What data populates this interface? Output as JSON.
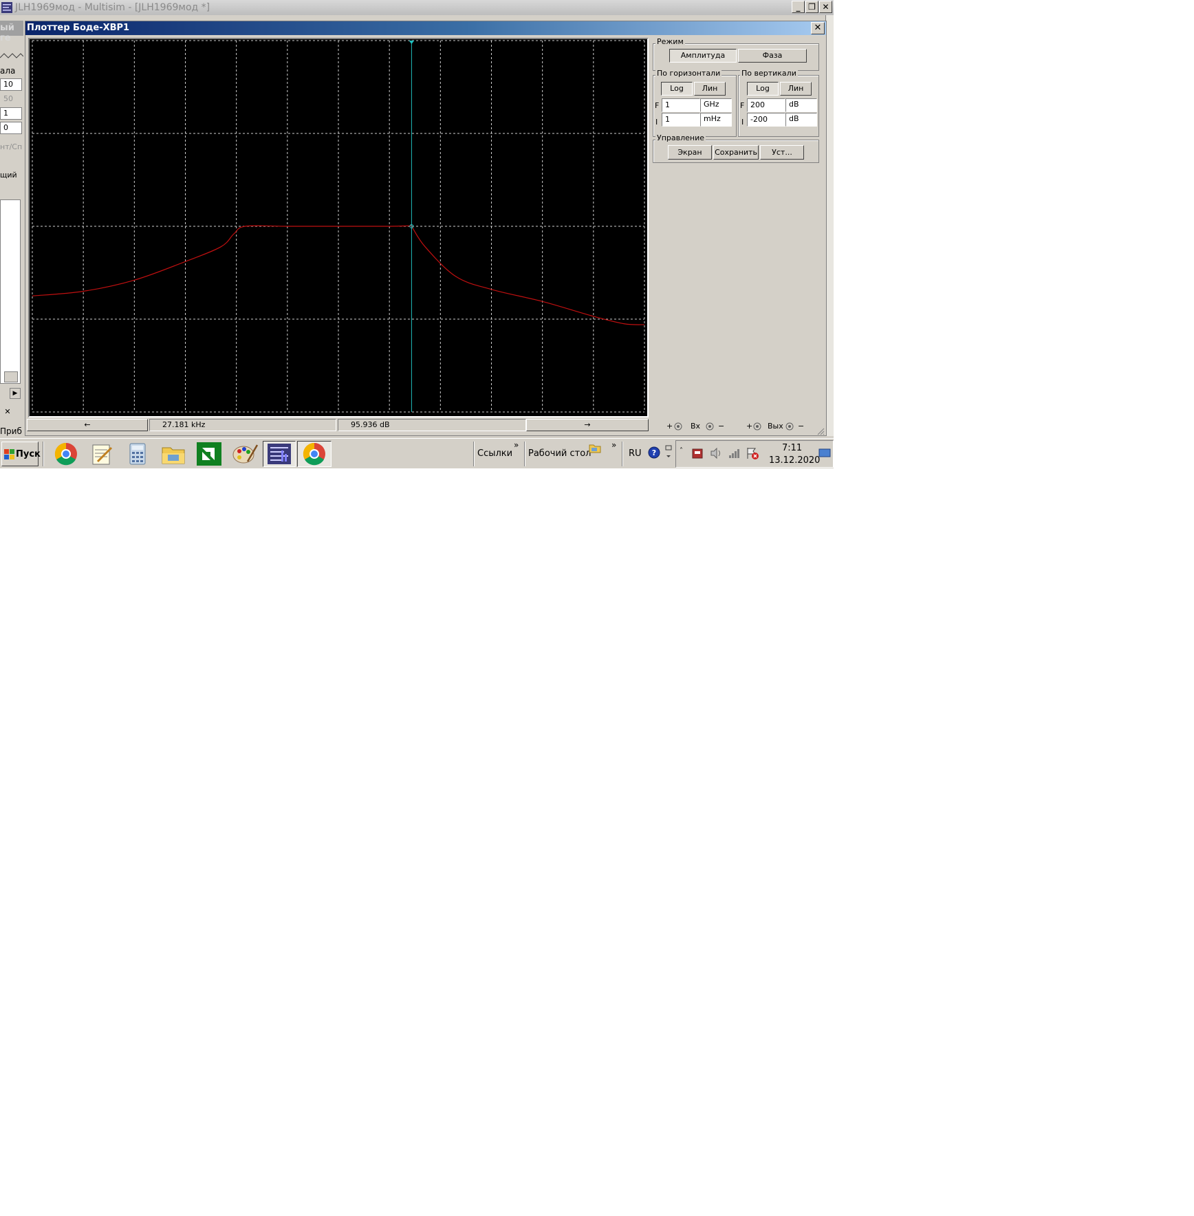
{
  "main_window": {
    "title": "JLH1969мод - Multisim - [JLH1969мод *]",
    "buttons": {
      "minimize": "_",
      "restore": "❐",
      "close": "✕"
    }
  },
  "left_panel": {
    "partial_title": "ый ге",
    "label_ala": "ала",
    "field1": "10",
    "field2": "50",
    "field3": "1",
    "field4": "0",
    "text_cut": "нт/Сп",
    "text_shch": "щий",
    "bottom_label": "Приб"
  },
  "bode": {
    "title": "Плоттер Боде-XBP1",
    "close": "✕",
    "mode": {
      "label": "Режим",
      "amplitude": "Амплитуда",
      "phase": "Фаза"
    },
    "horizontal": {
      "label": "По горизонтали",
      "log": "Log",
      "lin": "Лин",
      "f_label": "F",
      "f_value": "1",
      "f_unit": "GHz",
      "i_label": "I",
      "i_value": "1",
      "i_unit": "mHz"
    },
    "vertical": {
      "label": "По вертикали",
      "log": "Log",
      "lin": "Лин",
      "f_label": "F",
      "f_value": "200",
      "f_unit": "dB",
      "i_label": "I",
      "i_value": "-200",
      "i_unit": "dB"
    },
    "control": {
      "label": "Управление",
      "screen": "Экран",
      "save": "Сохранить",
      "settings": "Уст..."
    },
    "cursor": {
      "frequency": "27.181 kHz",
      "value": "95.936 dB",
      "left_arrow": "←",
      "right_arrow": "→"
    },
    "terminals": {
      "plus": "+",
      "minus": "−",
      "in": "Вх",
      "out": "Вых"
    }
  },
  "chart_data": {
    "type": "line",
    "x_scale": "log",
    "xlim_hz": [
      0.001,
      1000000000
    ],
    "ylim_db": [
      -200,
      200
    ],
    "grid": true,
    "series": [
      {
        "color": "#c01010",
        "x_hz": [
          0.001,
          0.01,
          0.1,
          1,
          5,
          9,
          15,
          100,
          1000,
          10000,
          25000,
          27181,
          50000,
          200000,
          1000000,
          10000000,
          100000000,
          400000000,
          1000000000
        ],
        "y_db": [
          -75,
          -70,
          -58,
          -38,
          -22,
          -8,
          0,
          0,
          0,
          0,
          0.5,
          0,
          -22,
          -54,
          -68,
          -81,
          -97,
          -105,
          -106
        ]
      }
    ],
    "cursor_x_hz": 27181,
    "cursor_y_db": 95.936
  },
  "taskbar": {
    "start": "Пуск",
    "links": "Ссылки",
    "desktop": "Рабочий стол",
    "chevron": "»",
    "lang": "RU",
    "time": "7:11",
    "date": "13.12.2020"
  }
}
